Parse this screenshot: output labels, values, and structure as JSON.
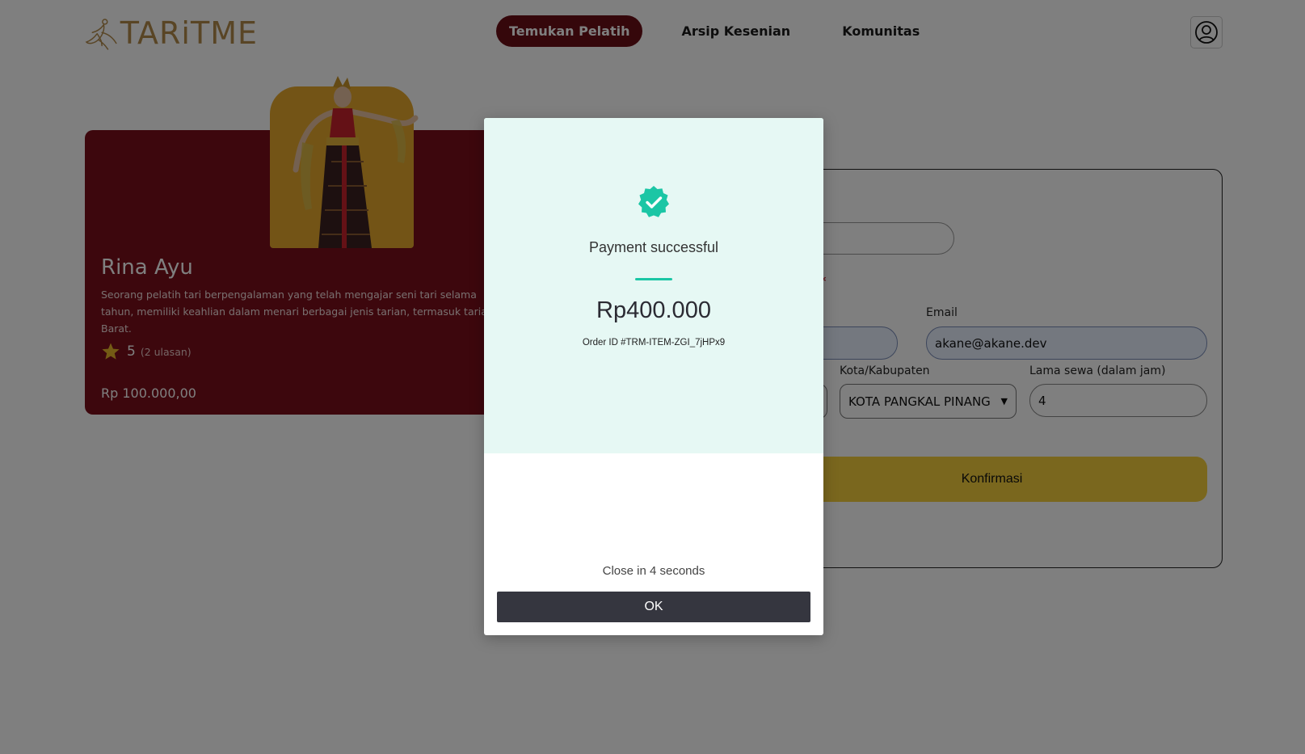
{
  "header": {
    "logo_text": "TARiTME",
    "nav": [
      {
        "label": "Temukan Pelatih",
        "active": true
      },
      {
        "label": "Arsip Kesenian",
        "active": false
      },
      {
        "label": "Komunitas",
        "active": false
      }
    ]
  },
  "trainer": {
    "name": "Rina Ayu",
    "description_lines": [
      "Seorang pelatih tari berpengalaman yang telah mengajar seni tari selama",
      "tahun, memiliki keahlian dalam menari berbagai jenis tarian, termasuk taria",
      "Barat."
    ],
    "rating": "5",
    "rating_count": "(2 ulasan)",
    "price": "Rp 100.000,00"
  },
  "booking": {
    "email_label": "Email",
    "email_value": "akane@akane.dev",
    "city_label": "Kota/Kabupaten",
    "city_value": "KOTA PANGKAL PINANG",
    "hours_label": "Lama sewa (dalam jam)",
    "hours_value": "4",
    "confirm_label": "Konfirmasi"
  },
  "modal": {
    "title": "Payment successful",
    "amount": "Rp400.000",
    "order_id": "Order ID #TRM-ITEM-ZGI_7jHPx9",
    "close_text": "Close in 4 seconds",
    "ok_label": "OK"
  },
  "colors": {
    "brand": "#6b0f16",
    "card": "#7a0f1a",
    "accent_gold": "#f4cf3d",
    "success": "#1bc6a5"
  }
}
